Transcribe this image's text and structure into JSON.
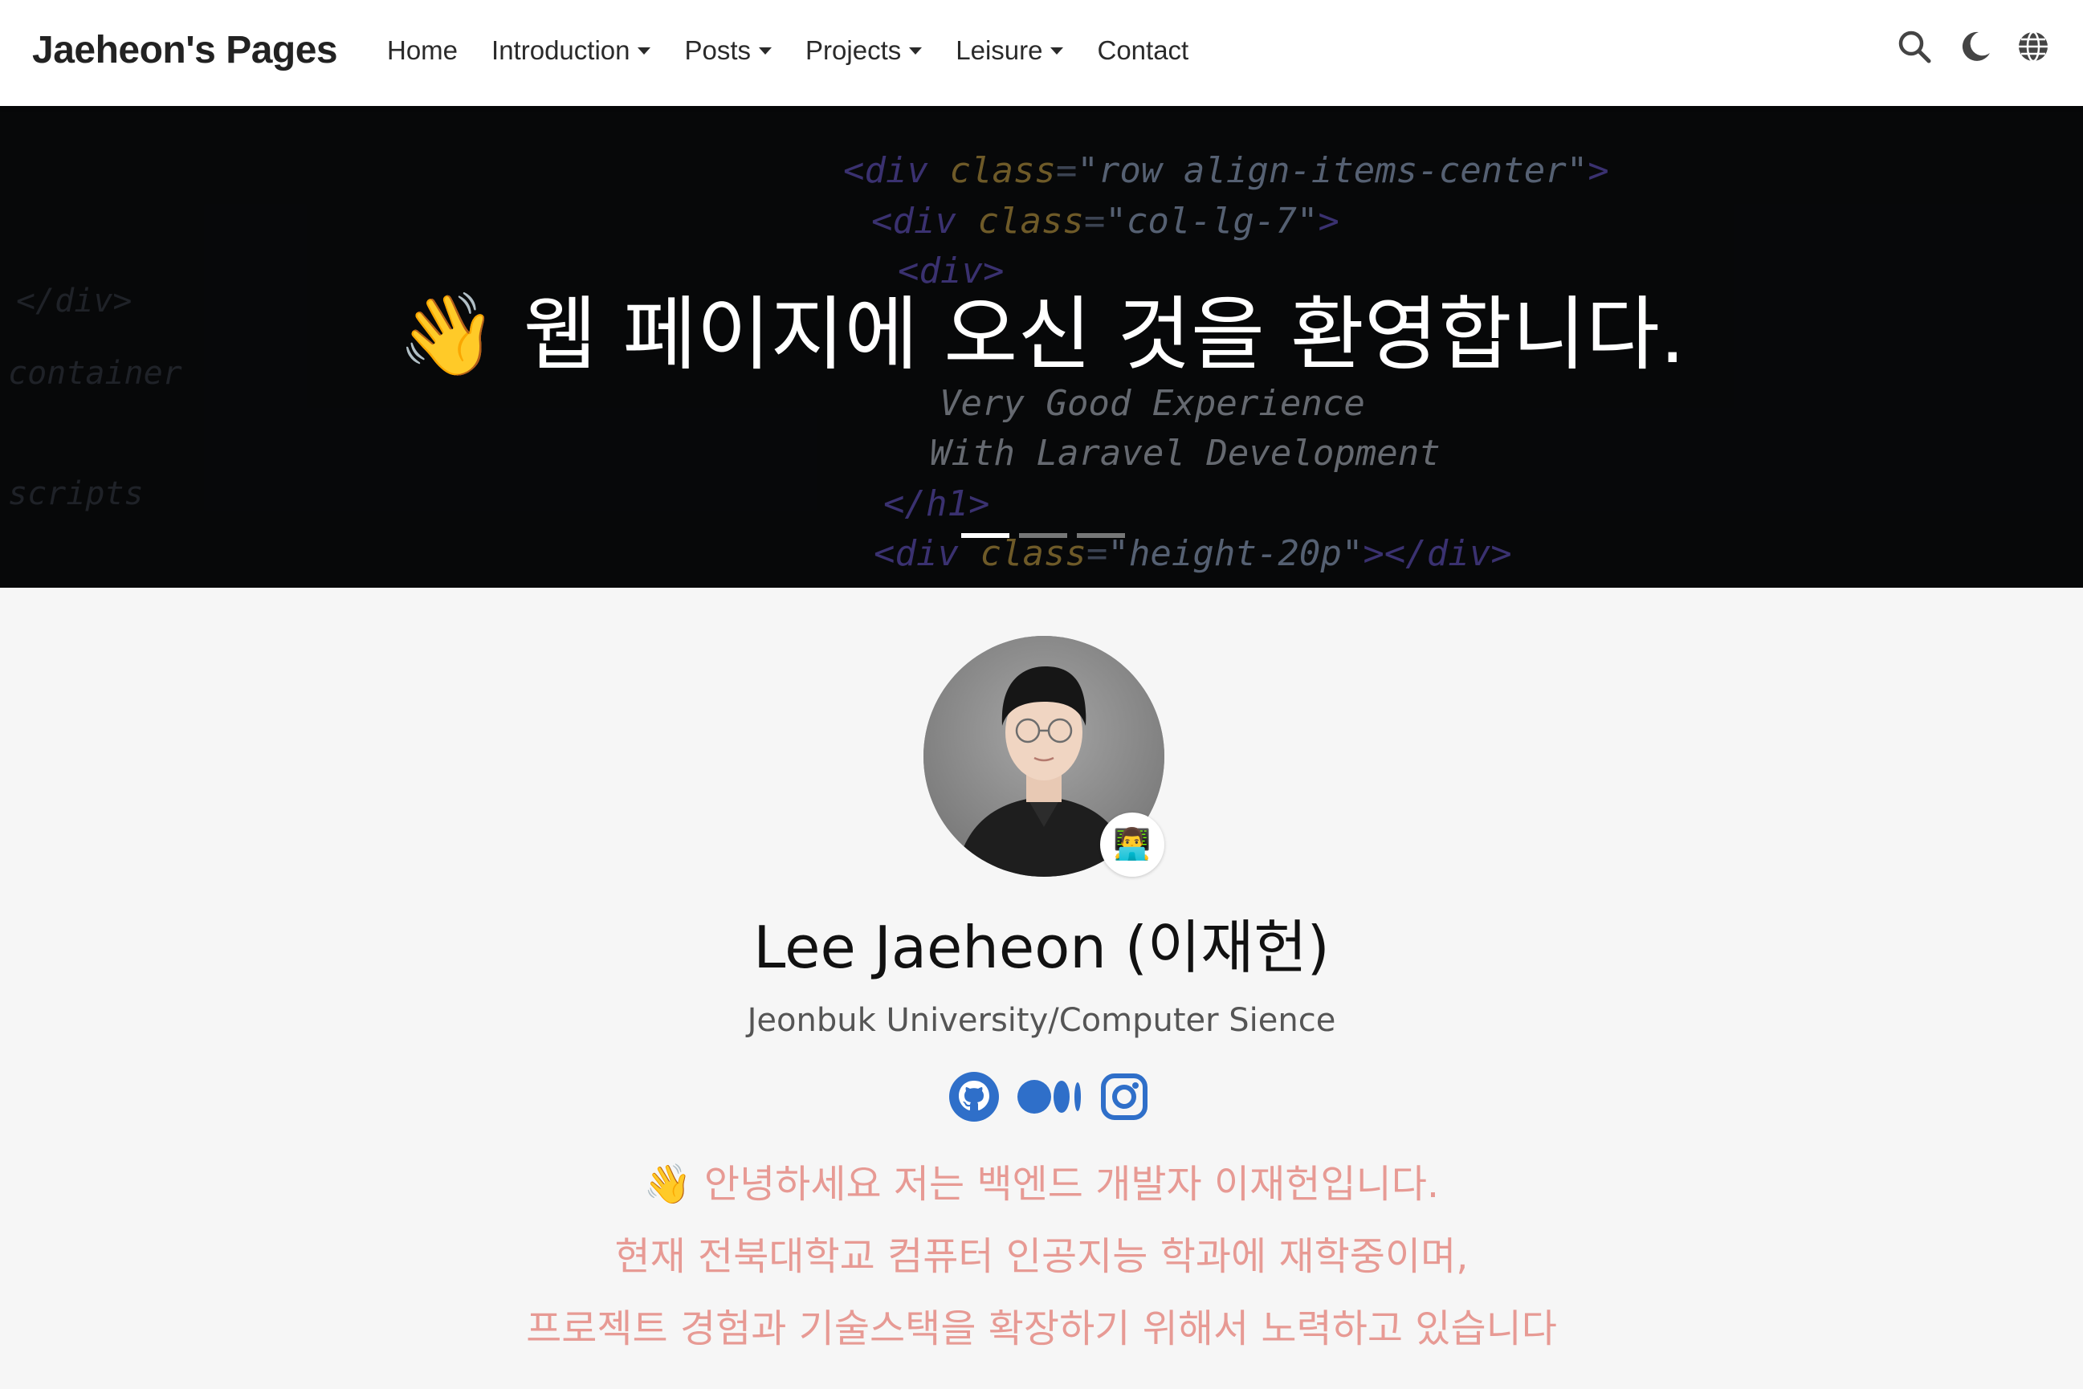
{
  "navbar": {
    "brand": "Jaeheon's Pages",
    "items": [
      {
        "label": "Home",
        "dropdown": false
      },
      {
        "label": "Introduction",
        "dropdown": true
      },
      {
        "label": "Posts",
        "dropdown": true
      },
      {
        "label": "Projects",
        "dropdown": true
      },
      {
        "label": "Leisure",
        "dropdown": true
      },
      {
        "label": "Contact",
        "dropdown": false
      }
    ],
    "icons": [
      "search-icon",
      "moon-icon",
      "globe-icon"
    ]
  },
  "hero": {
    "title": "👋 웹 페이지에 오신 것을 환영합니다.",
    "slides": 3,
    "active_slide": 1
  },
  "profile": {
    "name": "Lee Jaeheon (이재헌)",
    "affiliation": "Jeonbuk University/Computer Sience",
    "badge_emoji": "👨‍💻",
    "socials": [
      "github-icon",
      "medium-icon",
      "instagram-icon"
    ],
    "bio": [
      "👋 안녕하세요 저는 백엔드 개발자 이재헌입니다.",
      "현재 전북대학교 컴퓨터 인공지능 학과에 재학중이며,",
      "프로젝트 경험과 기술스택을 확장하기 위해서 노력하고 있습니다"
    ]
  },
  "colors": {
    "accent": "#2f6fc9",
    "bio_text": "#e79a94",
    "hero_bg": "#0d0f12"
  }
}
